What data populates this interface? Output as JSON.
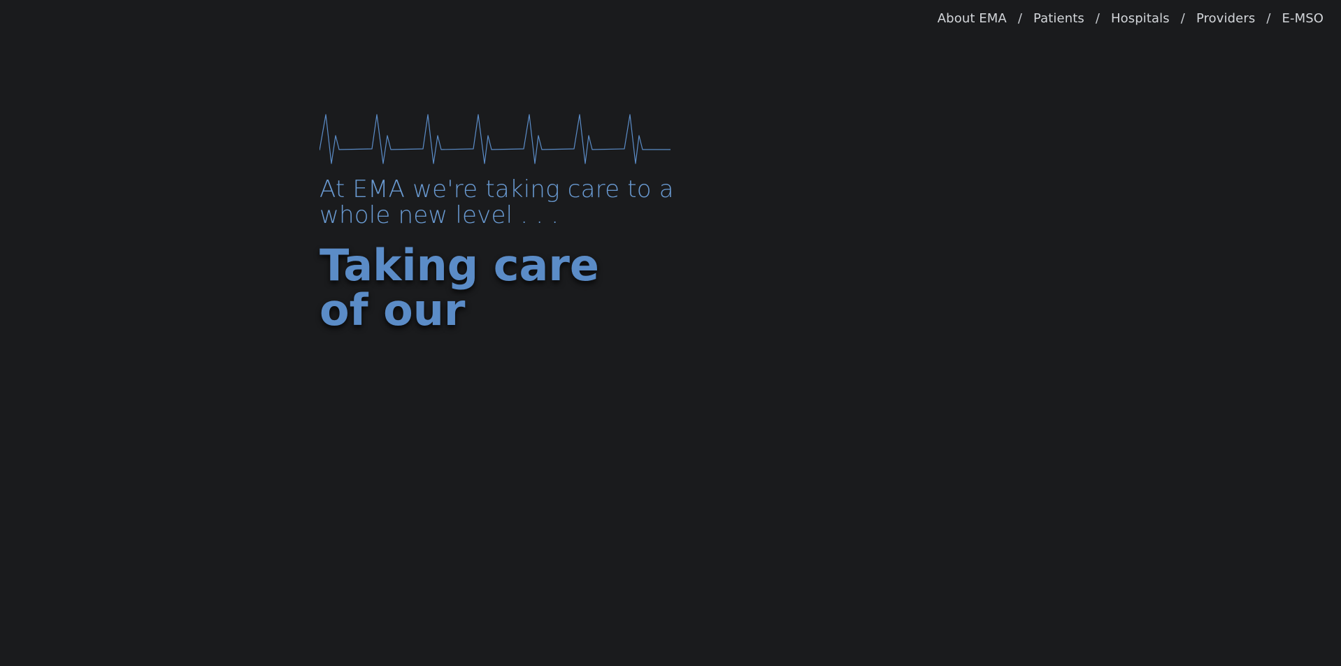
{
  "nav": {
    "items": [
      {
        "label": "About EMA"
      },
      {
        "label": "Patients"
      },
      {
        "label": "Hospitals"
      },
      {
        "label": "Providers"
      },
      {
        "label": "E-MSO"
      }
    ],
    "separator": "/"
  },
  "hero": {
    "intro": "At EMA we're taking care to a whole new level . . .",
    "headline": "Taking care of our"
  },
  "colors": {
    "background": "#1a1b1d",
    "accent": "#5b8cc7",
    "nav_text": "#d3d6da"
  },
  "icons": {
    "ekg": "heartbeat-line-icon"
  }
}
